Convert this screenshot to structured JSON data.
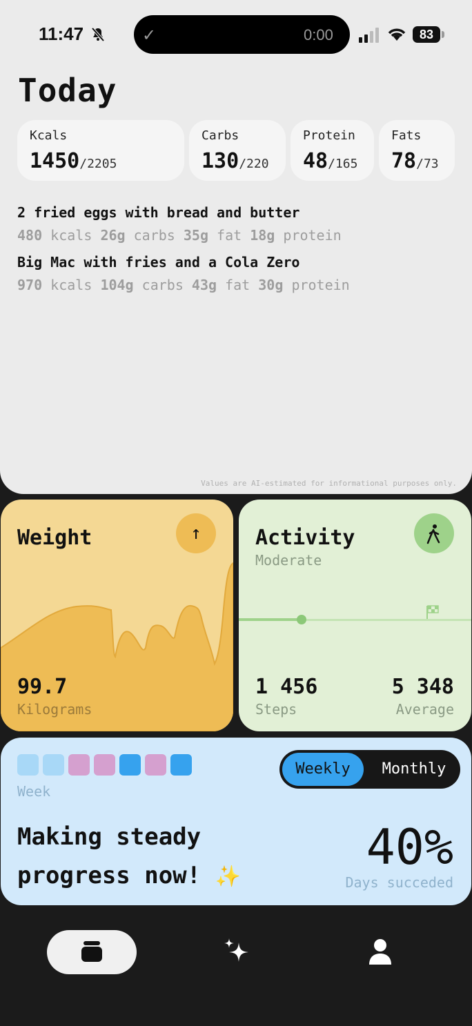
{
  "status_bar": {
    "time": "11:47",
    "timer": "0:00",
    "battery": "83"
  },
  "page_title": "Today",
  "macros": [
    {
      "label": "Kcals",
      "value": "1450",
      "goal": "/2205"
    },
    {
      "label": "Carbs",
      "value": "130",
      "goal": "/220"
    },
    {
      "label": "Protein",
      "value": "48",
      "goal": "/165"
    },
    {
      "label": "Fats",
      "value": "78",
      "goal": "/73"
    }
  ],
  "meals": [
    {
      "title": "2 fried eggs with bread and butter",
      "kcals": "480",
      "kcals_unit": "kcals",
      "carbs": "26g",
      "carbs_unit": "carbs",
      "fat": "35g",
      "fat_unit": "fat",
      "protein": "18g",
      "protein_unit": "protein"
    },
    {
      "title": "Big Mac with fries and a Cola Zero",
      "kcals": "970",
      "kcals_unit": "kcals",
      "carbs": "104g",
      "carbs_unit": "carbs",
      "fat": "43g",
      "fat_unit": "fat",
      "protein": "30g",
      "protein_unit": "protein"
    }
  ],
  "disclaimer": "Values are AI-estimated for informational purposes only.",
  "weight": {
    "title": "Weight",
    "value": "99.7",
    "unit": "Kilograms",
    "color_bg": "#f4d894",
    "color_fill": "#eebc55"
  },
  "activity": {
    "title": "Activity",
    "level": "Moderate",
    "steps": "1 456",
    "steps_label": "Steps",
    "average": "5 348",
    "average_label": "Average",
    "progress_fraction": 0.27,
    "color_bg": "#e2f0d6",
    "color_accent": "#9ed28a"
  },
  "progress": {
    "week_label": "Week",
    "toggle_selected": "Weekly",
    "toggle_other": "Monthly",
    "message_line1": "Making steady",
    "message_line2": "progress now!",
    "sparkle": "✨",
    "percent": "40%",
    "percent_label": "Days succeded",
    "day_colors": [
      "#a8d8f7",
      "#a8d8f7",
      "#d5a0cf",
      "#d5a0cf",
      "#36a2ee",
      "#d5a0cf",
      "#36a2ee"
    ]
  },
  "nav": {
    "items": [
      "jar-icon",
      "sparkles-icon",
      "person-icon"
    ],
    "active": "jar-icon"
  }
}
